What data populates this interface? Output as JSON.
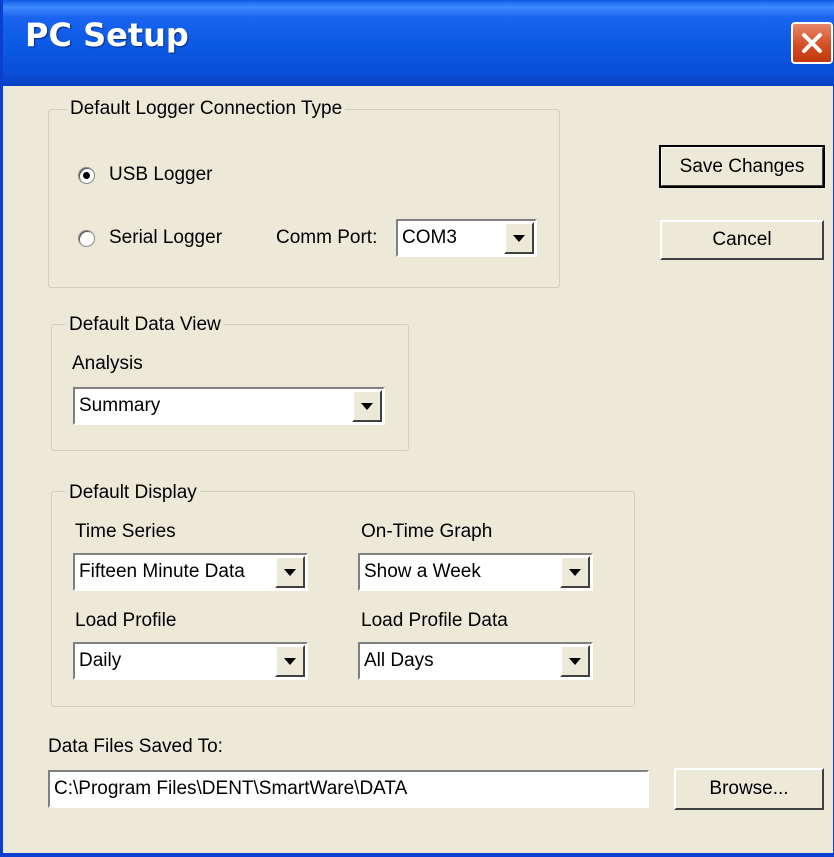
{
  "window": {
    "title": "PC Setup"
  },
  "connection": {
    "legend": "Default Logger Connection Type",
    "usb_label": "USB Logger",
    "serial_label": "Serial Logger",
    "selected": "usb",
    "comm_port_label": "Comm Port:",
    "comm_port_value": "COM3"
  },
  "buttons": {
    "save": "Save Changes",
    "cancel": "Cancel",
    "browse": "Browse..."
  },
  "data_view": {
    "legend": "Default Data View",
    "analysis_label": "Analysis",
    "analysis_value": "Summary"
  },
  "display": {
    "legend": "Default Display",
    "time_series_label": "Time Series",
    "time_series_value": "Fifteen Minute Data",
    "on_time_label": "On-Time Graph",
    "on_time_value": "Show a Week",
    "load_profile_label": "Load Profile",
    "load_profile_value": "Daily",
    "load_profile_data_label": "Load Profile Data",
    "load_profile_data_value": "All Days"
  },
  "files": {
    "label": "Data Files Saved To:",
    "path": "C:\\Program Files\\DENT\\SmartWare\\DATA"
  },
  "colors": {
    "titlebar": "#0a58e4",
    "close_button": "#d24a1e",
    "dialog_bg": "#ece9d8"
  }
}
